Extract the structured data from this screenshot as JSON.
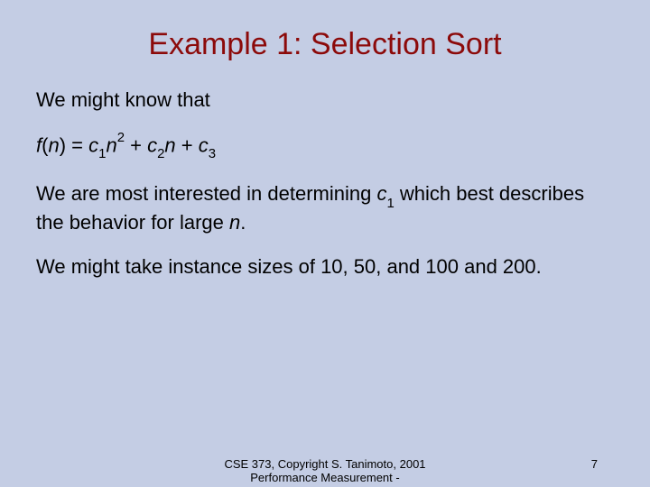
{
  "title": "Example 1: Selection Sort",
  "p1": "We might know that",
  "formula": {
    "lhs_f": "f",
    "lhs_paren_open": "(",
    "lhs_n": "n",
    "lhs_paren_close": ") = ",
    "c": "c",
    "s1": "1",
    "n": "n",
    "sq": "2",
    "plus1": " + ",
    "s2": "2",
    "plus2": " + ",
    "s3": "3"
  },
  "p3a": "We are most interested in determining ",
  "p3b": " which best describes the behavior for large ",
  "p3c": ".",
  "p4": "We might take instance sizes of 10, 50, and 100 and 200.",
  "footer_center_l1": "CSE 373,  Copyright S. Tanimoto, 2001",
  "footer_center_l2": "Performance Measurement -",
  "page_num": "7"
}
